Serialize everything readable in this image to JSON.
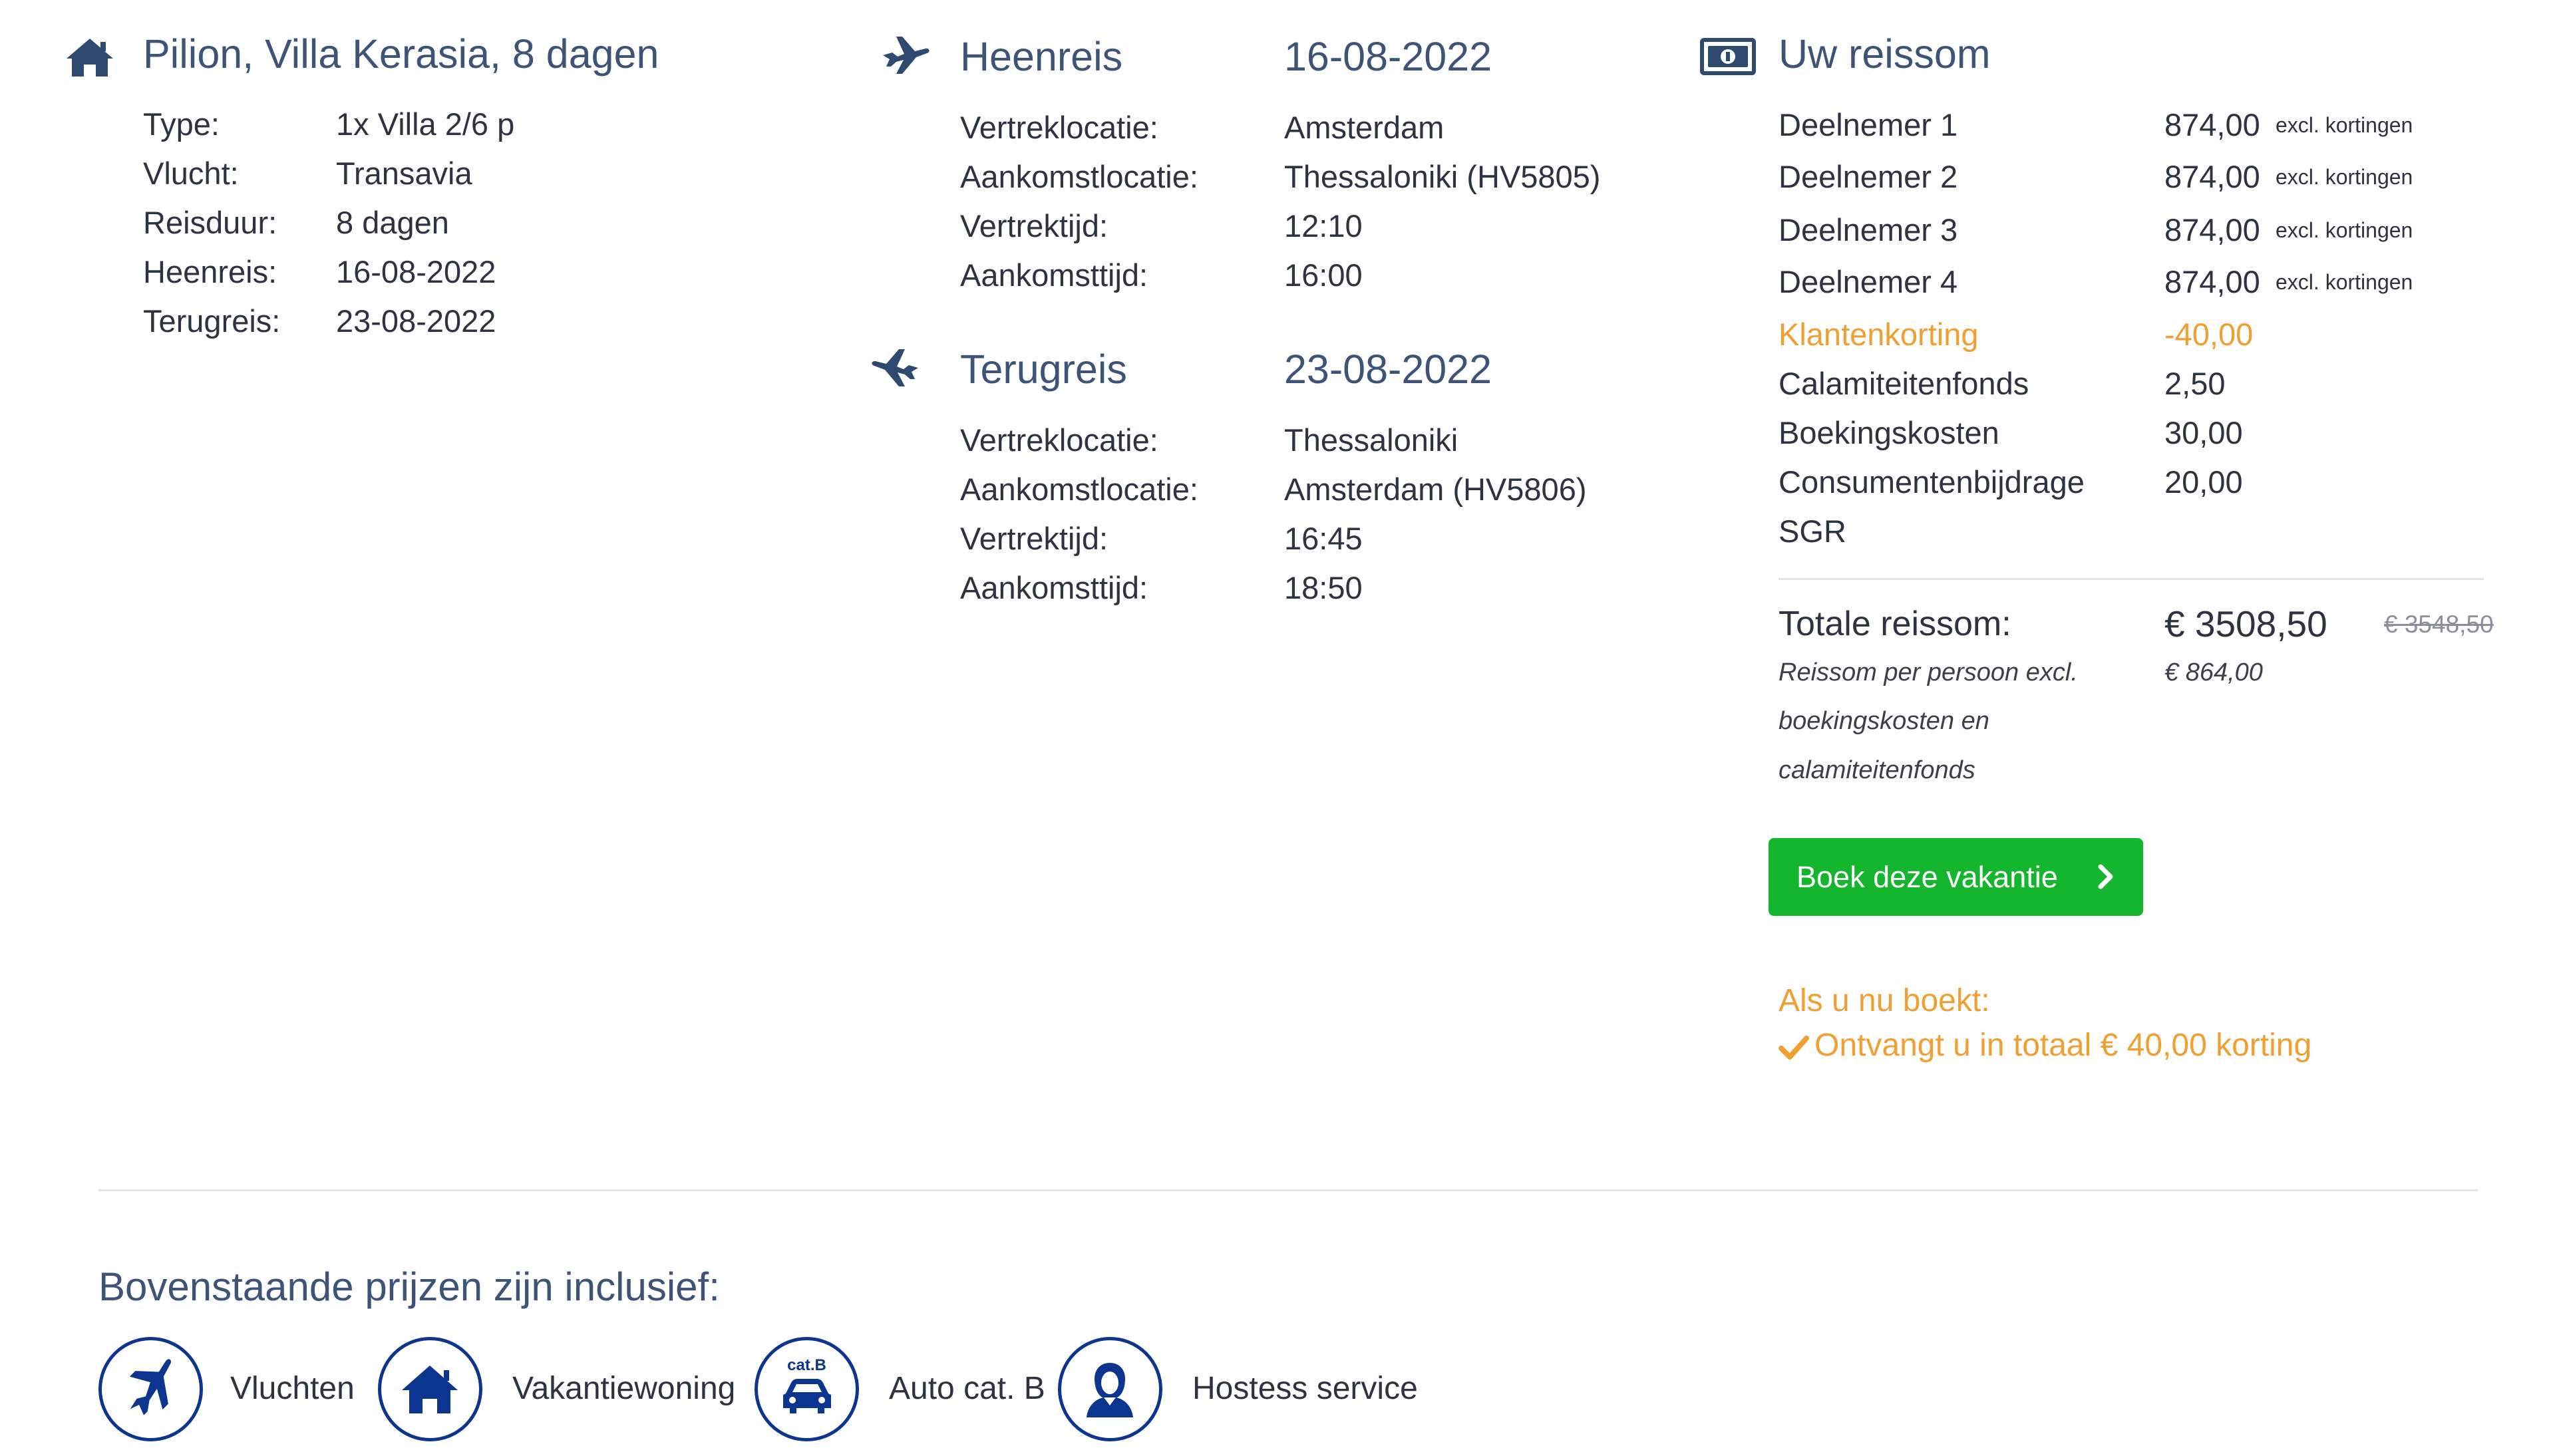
{
  "accommodation": {
    "title": "Pilion, Villa Kerasia, 8 dagen",
    "rows": [
      {
        "label": "Type:",
        "value": "1x Villa 2/6 p"
      },
      {
        "label": "Vlucht:",
        "value": "Transavia"
      },
      {
        "label": "Reisduur:",
        "value": "8 dagen"
      },
      {
        "label": "Heenreis:",
        "value": "16-08-2022"
      },
      {
        "label": "Terugreis:",
        "value": "23-08-2022"
      }
    ]
  },
  "outbound": {
    "title": "Heenreis",
    "date": "16-08-2022",
    "rows": [
      {
        "label": "Vertreklocatie:",
        "value": "Amsterdam"
      },
      {
        "label": "Aankomstlocatie:",
        "value": "Thessaloniki (HV5805)"
      },
      {
        "label": "Vertrektijd:",
        "value": "12:10"
      },
      {
        "label": "Aankomsttijd:",
        "value": "16:00"
      }
    ]
  },
  "inbound": {
    "title": "Terugreis",
    "date": "23-08-2022",
    "rows": [
      {
        "label": "Vertreklocatie:",
        "value": "Thessaloniki"
      },
      {
        "label": "Aankomstlocatie:",
        "value": "Amsterdam (HV5806)"
      },
      {
        "label": "Vertrektijd:",
        "value": "16:45"
      },
      {
        "label": "Aankomsttijd:",
        "value": "18:50"
      }
    ]
  },
  "price": {
    "title": "Uw reissom",
    "participants": [
      {
        "label": "Deelnemer 1",
        "value": "874,00",
        "note": "excl. kortingen"
      },
      {
        "label": "Deelnemer 2",
        "value": "874,00",
        "note": "excl. kortingen"
      },
      {
        "label": "Deelnemer 3",
        "value": "874,00",
        "note": "excl. kortingen"
      },
      {
        "label": "Deelnemer 4",
        "value": "874,00",
        "note": "excl. kortingen"
      }
    ],
    "discount": {
      "label": "Klantenkorting",
      "value": "-40,00"
    },
    "fees": [
      {
        "label": "Calamiteitenfonds",
        "value": "2,50"
      },
      {
        "label": "Boekingskosten",
        "value": "30,00"
      },
      {
        "label": "Consumentenbijdrage",
        "value": "20,00"
      }
    ],
    "fees_extra_line": "SGR",
    "total_label": "Totale reissom:",
    "total_value": "€ 3508,50",
    "old_total": "€ 3548,50",
    "per_person_lines": [
      "Reissom per persoon excl.",
      "boekingskosten en",
      "calamiteitenfonds"
    ],
    "per_person_value": "€ 864,00",
    "book_button": "Boek deze vakantie",
    "promo_line1": "Als u nu boekt:",
    "promo_line2": "Ontvangt u in totaal € 40,00 korting"
  },
  "inclusive": {
    "title": "Bovenstaande prijzen zijn inclusief:",
    "items": [
      "Vluchten",
      "Vakantiewoning",
      "Auto cat. B",
      "Hostess service"
    ],
    "car_badge": "cat.B"
  },
  "colors": {
    "heading": "#3d5478",
    "text": "#2d3340",
    "orange": "#f0a033",
    "green_button": "#14b62e",
    "icon_navy": "#0c3590"
  }
}
